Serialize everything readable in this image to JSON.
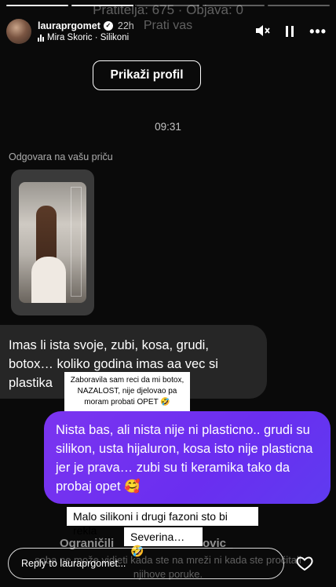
{
  "faded_header": {
    "line1": "Pratitelja: 675 · Objava: 0",
    "line2": "Prati vas"
  },
  "story": {
    "segments": 5,
    "current_segment": 2,
    "username": "lauraprgomet",
    "time_ago": "22h",
    "music": "Mira Skoric · Silikoni"
  },
  "icons": {
    "mute": "mute-icon",
    "pause": "pause-icon",
    "more": "more-icon",
    "verified": "verified-badge-icon",
    "heart": "heart-icon",
    "music": "music-bars-icon"
  },
  "profile_button": "Prikaži profil",
  "chat": {
    "time": "09:31",
    "reply_note": "Odgovara na vašu priču",
    "received": "Imas li ista svoje, zubi, kosa, grudi, botox… koliko godina imas aa vec si plastika",
    "sent": "Nista bas, ali nista nije ni plasticno.. grudi su silikon, usta hijaluron, kosa isto nije plasticna jer je prava… zubi su ti keramika tako da probaj opet 🥰"
  },
  "stickers": {
    "s1": "Zaboravila sam reci da mi botox, NAZALOST, nije djelovao pa moram probati OPET 🤣",
    "s2": "Malo silikoni i drugi fazoni sto bi rekla",
    "s3": "Severina…🤣"
  },
  "faded_footer": {
    "restrict": "Ograničili",
    "name_tail": "ovic_",
    "line1": "soba ne može vidjeti kada ste na mreži ni kada ste pročitali",
    "line2": "njihove poruke."
  },
  "reply": {
    "placeholder": "Reply to lauraprgomet..."
  }
}
